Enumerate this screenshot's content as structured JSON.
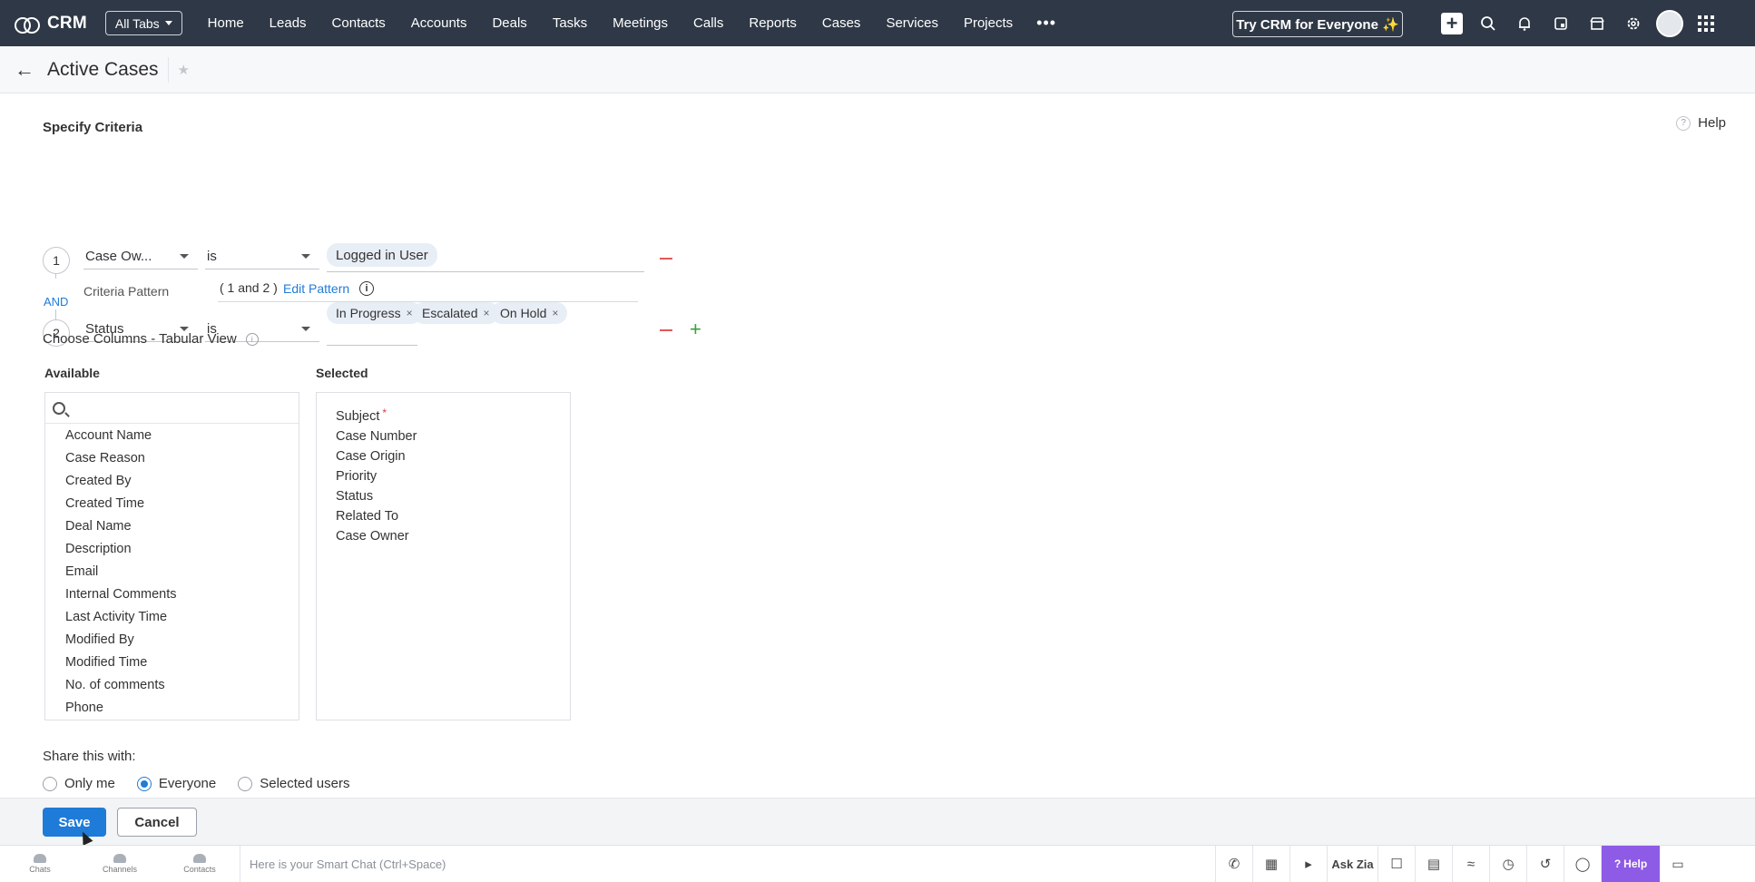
{
  "topnav": {
    "app_name": "CRM",
    "all_tabs_label": "All Tabs",
    "tabs": [
      "Home",
      "Leads",
      "Contacts",
      "Accounts",
      "Deals",
      "Tasks",
      "Meetings",
      "Calls",
      "Reports",
      "Cases",
      "Services",
      "Projects"
    ],
    "more_label": "•••",
    "try_label": "Try CRM for Everyone ✨"
  },
  "header": {
    "title": "Active Cases"
  },
  "criteria": {
    "section_title": "Specify Criteria",
    "help_label": "Help",
    "connector": "AND",
    "rows": [
      {
        "number": "1",
        "field": "Case Ow...",
        "operator": "is",
        "values": [
          "Logged in User"
        ]
      },
      {
        "number": "2",
        "field": "Status",
        "operator": "is",
        "values": [
          "In Progress",
          "Escalated",
          "On Hold"
        ]
      }
    ],
    "pattern_label": "Criteria Pattern",
    "pattern_value": "( 1 and 2 )",
    "edit_pattern_label": "Edit Pattern"
  },
  "columns": {
    "section_title": "Choose Columns - Tabular View",
    "available_label": "Available",
    "selected_label": "Selected",
    "available": [
      "Account Name",
      "Case Reason",
      "Created By",
      "Created Time",
      "Deal Name",
      "Description",
      "Email",
      "Internal Comments",
      "Last Activity Time",
      "Modified By",
      "Modified Time",
      "No. of comments",
      "Phone"
    ],
    "selected": [
      "Subject",
      "Case Number",
      "Case Origin",
      "Priority",
      "Status",
      "Related To",
      "Case Owner"
    ]
  },
  "share": {
    "title": "Share this with:",
    "options": [
      "Only me",
      "Everyone",
      "Selected users"
    ],
    "selected": "Everyone"
  },
  "actions": {
    "save_label": "Save",
    "cancel_label": "Cancel"
  },
  "bottombar": {
    "items": [
      "Chats",
      "Channels",
      "Contacts"
    ],
    "smart_chat_placeholder": "Here is your Smart Chat (Ctrl+Space)",
    "ask_zia_label": "Ask Zia",
    "help_label": "Help"
  },
  "colors": {
    "nav_bg": "#2f3846",
    "primary": "#1f7bd8",
    "help_purple": "#8e5be6"
  }
}
